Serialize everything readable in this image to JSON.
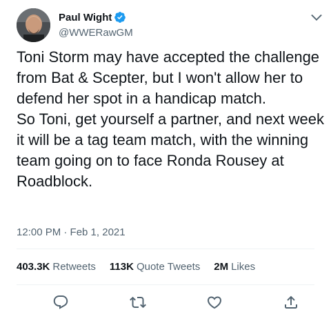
{
  "author": {
    "display_name": "Paul Wight",
    "handle": "@WWERawGM",
    "verified": true
  },
  "tweet": {
    "text": "Toni Storm may have accepted the challenge from Bat & Scepter, but I won't allow her to defend her spot in a handicap match.\nSo Toni, get yourself a partner, and next week it will be a tag team match, with the winning team going on to face Ronda Rousey at Roadblock.",
    "timestamp": "12:00 PM · Feb 1, 2021"
  },
  "stats": {
    "retweets_count": "403.3K",
    "retweets_label": "Retweets",
    "quotes_count": "113K",
    "quotes_label": "Quote Tweets",
    "likes_count": "2M",
    "likes_label": "Likes"
  },
  "icons": {
    "verified": "verified-badge-icon",
    "caret": "chevron-down-icon",
    "reply": "reply-icon",
    "retweet": "retweet-icon",
    "like": "heart-icon",
    "share": "share-icon"
  },
  "colors": {
    "accent": "#1d9bf0",
    "text_primary": "#0f1419",
    "text_secondary": "#536471",
    "divider": "#eff3f4"
  }
}
